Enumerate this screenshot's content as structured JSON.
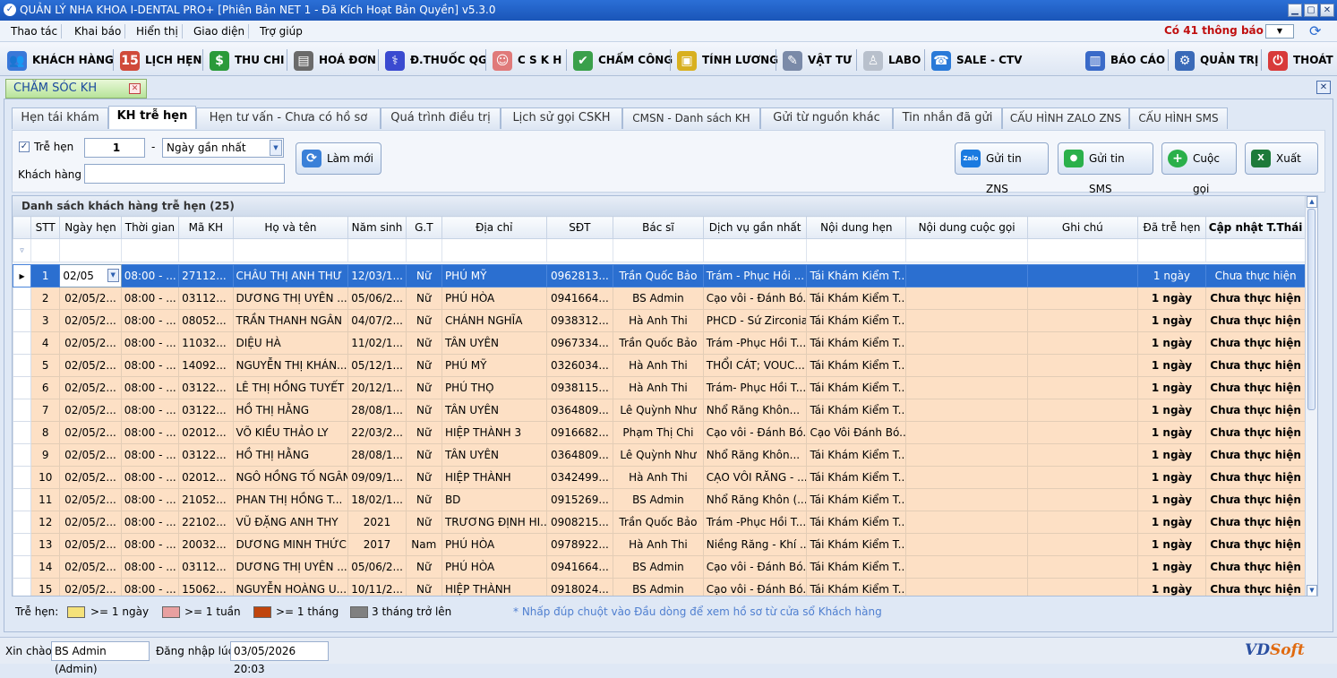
{
  "window": {
    "title": "QUẢN LÝ NHA KHOA I-DENTAL PRO+ [Phiên Bản NET 1 - Đã Kích Hoạt Bản Quyền] v5.3.0"
  },
  "menu": [
    "Thao tác",
    "Khai báo",
    "Hiển thị",
    "Giao diện",
    "Trợ giúp"
  ],
  "notification": "Có 41 thông báo",
  "toolbar": {
    "left": [
      "KHÁCH HÀNG",
      "LỊCH HẸN",
      "THU CHI",
      "HOÁ ĐƠN",
      "Đ.THUỐC QG",
      "C S K H",
      "CHẤM CÔNG",
      "TÍNH LƯƠNG",
      "VẬT TƯ",
      "LABO",
      "SALE - CTV"
    ],
    "right": [
      "BÁO CÁO",
      "QUẢN TRỊ",
      "THOÁT"
    ]
  },
  "doc_tab": "CHĂM SÓC KH",
  "tabs": [
    "Hẹn tái khám",
    "KH trễ hẹn",
    "Hẹn tư vấn - Chưa có hồ sơ",
    "Quá trình điều trị",
    "Lịch sử gọi CSKH",
    "CMSN - Danh sách KH",
    "Gửi từ nguồn khác",
    "Tin nhắn đã gửi",
    "CẤU HÌNH ZALO ZNS",
    "CẤU HÌNH SMS"
  ],
  "form": {
    "late_label": "Trễ hẹn",
    "late_value": "1",
    "dash": "-",
    "period": "Ngày gần nhất",
    "customer_label": "Khách hàng",
    "customer_value": "",
    "refresh": "Làm mới",
    "send_zns": "Gửi tin ZNS",
    "send_sms": "Gửi tin SMS",
    "call": "Cuộc gọi",
    "export": "Xuất",
    "zalo_icon_text": "Zalo"
  },
  "grid": {
    "title": "Danh sách khách hàng trễ hẹn (25)",
    "columns": [
      "STT",
      "Ngày hẹn",
      "Thời gian",
      "Mã KH",
      "Họ và tên",
      "Năm sinh",
      "G.T",
      "Địa chỉ",
      "SĐT",
      "Bác sĩ",
      "Dịch vụ gần nhất",
      "Nội dung hẹn",
      "Nội dung cuộc gọi",
      "Ghi chú",
      "Đã trễ hẹn",
      "Cập nhật T.Thái"
    ],
    "rows": [
      [
        "1",
        "02/05",
        "08:00 - ...",
        "27112...",
        "CHÂU THỊ ANH THƯ",
        "12/03/1...",
        "Nữ",
        "PHÚ MỸ",
        "0962813...",
        "Trần Quốc Bảo",
        "Trám - Phục Hồi ...",
        "Tái Khám Kiểm T...",
        "",
        "",
        "1 ngày",
        "Chưa thực hiện"
      ],
      [
        "2",
        "02/05/2...",
        "08:00 - ...",
        "03112...",
        "DƯƠNG THỊ UYÊN ...",
        "05/06/2...",
        "Nữ",
        "PHÚ HÒA",
        "0941664...",
        "BS Admin",
        "Cạo vôi - Đánh Bó...",
        "Tái Khám Kiểm T...",
        "",
        "",
        "1 ngày",
        "Chưa thực hiện"
      ],
      [
        "3",
        "02/05/2...",
        "08:00 - ...",
        "08052...",
        "TRẦN THANH NGÂN",
        "04/07/2...",
        "Nữ",
        "CHÁNH NGHĨA",
        "0938312...",
        "Hà Anh Thi",
        "PHCD - Sứ Zirconia",
        "Tái Khám Kiểm T...",
        "",
        "",
        "1 ngày",
        "Chưa thực hiện"
      ],
      [
        "4",
        "02/05/2...",
        "08:00 - ...",
        "11032...",
        "DIỆU HÀ",
        "11/02/1...",
        "Nữ",
        "TÂN UYÊN",
        "0967334...",
        "Trần Quốc Bảo",
        "Trám -Phục Hồi T...",
        "Tái Khám Kiểm T...",
        "",
        "",
        "1 ngày",
        "Chưa thực hiện"
      ],
      [
        "5",
        "02/05/2...",
        "08:00 - ...",
        "14092...",
        "NGUYỄN THỊ KHÁN...",
        "05/12/1...",
        "Nữ",
        "PHÚ MỸ",
        "0326034...",
        "Hà Anh Thi",
        "THỔI CÁT; VOUC...",
        "Tái Khám Kiểm T...",
        "",
        "",
        "1 ngày",
        "Chưa thực hiện"
      ],
      [
        "6",
        "02/05/2...",
        "08:00 - ...",
        "03122...",
        "LÊ THỊ HỒNG TUYẾT",
        "20/12/1...",
        "Nữ",
        "PHÚ THỌ",
        "0938115...",
        "Hà Anh Thi",
        "Trám- Phục Hồi T...",
        "Tái Khám Kiểm T...",
        "",
        "",
        "1 ngày",
        "Chưa thực hiện"
      ],
      [
        "7",
        "02/05/2...",
        "08:00 - ...",
        "03122...",
        "HỒ THỊ HẰNG",
        "28/08/1...",
        "Nữ",
        "TÂN UYÊN",
        "0364809...",
        "Lê Quỳnh Như",
        "Nhổ Răng Khôn...",
        "Tái Khám Kiểm T...",
        "",
        "",
        "1 ngày",
        "Chưa thực hiện"
      ],
      [
        "8",
        "02/05/2...",
        "08:00 - ...",
        "02012...",
        "VÕ KIỀU THẢO LY",
        "22/03/2...",
        "Nữ",
        "HIỆP THÀNH 3",
        "0916682...",
        "Phạm Thị Chi",
        "Cạo vôi - Đánh Bó...",
        "Cạo Vôi Đánh Bó...",
        "",
        "",
        "1 ngày",
        "Chưa thực hiện"
      ],
      [
        "9",
        "02/05/2...",
        "08:00 - ...",
        "03122...",
        "HỒ THỊ HẰNG",
        "28/08/1...",
        "Nữ",
        "TÂN UYÊN",
        "0364809...",
        "Lê Quỳnh Như",
        "Nhổ Răng Khôn...",
        "Tái Khám Kiểm T...",
        "",
        "",
        "1 ngày",
        "Chưa thực hiện"
      ],
      [
        "10",
        "02/05/2...",
        "08:00 - ...",
        "02012...",
        "NGÔ HỒNG TỐ NGÂN",
        "09/09/1...",
        "Nữ",
        "HIỆP THÀNH",
        "0342499...",
        "Hà Anh Thi",
        "CẠO VÔI RĂNG - ...",
        "Tái Khám Kiểm T...",
        "",
        "",
        "1 ngày",
        "Chưa thực hiện"
      ],
      [
        "11",
        "02/05/2...",
        "08:00 - ...",
        "21052...",
        "PHAN THỊ HỒNG T...",
        "18/02/1...",
        "Nữ",
        "BD",
        "0915269...",
        "BS Admin",
        "Nhổ Răng Khôn (...",
        "Tái Khám Kiểm T...",
        "",
        "",
        "1 ngày",
        "Chưa thực hiện"
      ],
      [
        "12",
        "02/05/2...",
        "08:00 - ...",
        "22102...",
        "VŨ ĐẶNG ANH THY",
        "2021",
        "Nữ",
        "TRƯƠNG ĐỊNH HI...",
        "0908215...",
        "Trần Quốc Bảo",
        "Trám -Phục Hồi T...",
        "Tái Khám Kiểm T...",
        "",
        "",
        "1 ngày",
        "Chưa thực hiện"
      ],
      [
        "13",
        "02/05/2...",
        "08:00 - ...",
        "20032...",
        "DƯƠNG MINH THỨC",
        "2017",
        "Nam",
        "PHÚ HÒA",
        "0978922...",
        "Hà Anh Thi",
        "Niềng Răng - Khí ...",
        "Tái Khám Kiểm T...",
        "",
        "",
        "1 ngày",
        "Chưa thực hiện"
      ],
      [
        "14",
        "02/05/2...",
        "08:00 - ...",
        "03112...",
        "DƯƠNG THỊ UYÊN ...",
        "05/06/2...",
        "Nữ",
        "PHÚ HÒA",
        "0941664...",
        "BS Admin",
        "Cạo vôi - Đánh Bó...",
        "Tái Khám Kiểm T...",
        "",
        "",
        "1 ngày",
        "Chưa thực hiện"
      ],
      [
        "15",
        "02/05/2...",
        "08:00 - ...",
        "15062...",
        "NGUYỄN HOÀNG U...",
        "10/11/2...",
        "Nữ",
        "HIỆP THÀNH",
        "0918024...",
        "BS Admin",
        "Cạo vôi - Đánh Bó...",
        "Tái Khám Kiểm T...",
        "",
        "",
        "1 ngày",
        "Chưa thực hiện"
      ]
    ]
  },
  "legend": {
    "label": "Trễ hẹn:",
    "items": [
      {
        "text": ">= 1 ngày",
        "color": "#f5e27a"
      },
      {
        "text": ">= 1 tuần",
        "color": "#e8a0a0"
      },
      {
        "text": ">= 1 tháng",
        "color": "#c0440c"
      },
      {
        "text": "3 tháng trở lên",
        "color": "#808080"
      }
    ],
    "hint": "* Nhấp đúp chuột vào Đầu dòng để xem hồ sơ từ cửa sổ Khách hàng"
  },
  "status": {
    "hello": "Xin chào",
    "user": "BS Admin (Admin)",
    "login_label": "Đăng nhập lúc",
    "login_time": "03/05/2026 20:03",
    "brand_a": "VD",
    "brand_b": "Soft"
  }
}
